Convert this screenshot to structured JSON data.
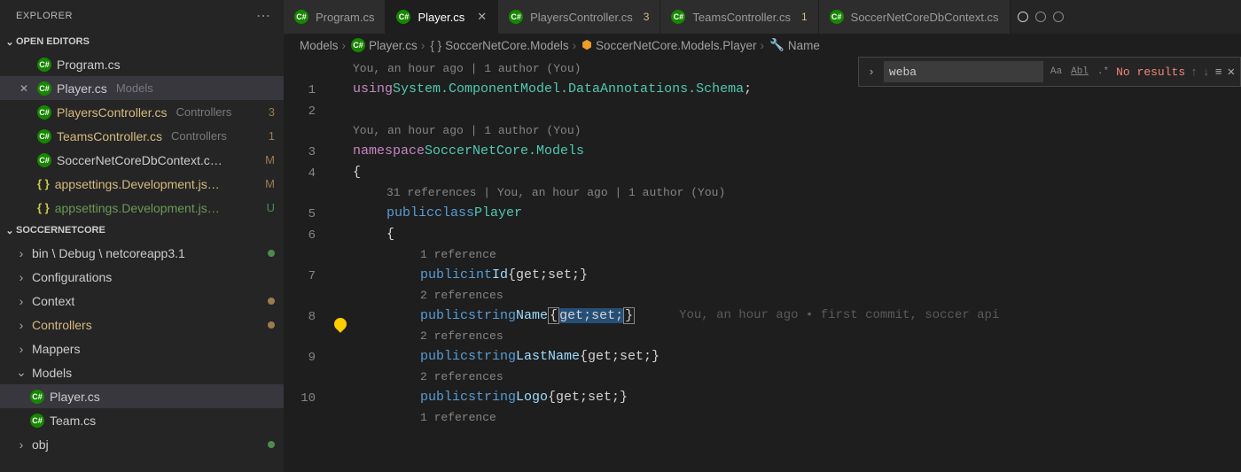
{
  "sidebar": {
    "title": "EXPLORER",
    "sections": {
      "open_editors": "OPEN EDITORS",
      "project": "SOCCERNETCORE"
    },
    "open_editors": [
      {
        "label": "Program.cs",
        "type": "cs"
      },
      {
        "label": "Player.cs",
        "dim": "Models",
        "type": "cs",
        "active": true,
        "closeable": true
      },
      {
        "label": "PlayersController.cs",
        "dim": "Controllers",
        "type": "cs",
        "git": "mod",
        "badge": "3"
      },
      {
        "label": "TeamsController.cs",
        "dim": "Controllers",
        "type": "cs",
        "git": "mod",
        "badge": "1"
      },
      {
        "label": "SoccerNetCoreDbContext.c…",
        "type": "cs",
        "badge": "M",
        "badgeClass": "mod"
      },
      {
        "label": "appsettings.Development.js…",
        "type": "json",
        "badge": "M",
        "badgeClass": "mod",
        "git": "mod"
      },
      {
        "label": "appsettings.Development.js…",
        "type": "json",
        "badge": "U",
        "badgeClass": "unt",
        "git": "unt"
      }
    ],
    "tree": [
      {
        "label": "bin \\ Debug \\ netcoreapp3.1",
        "dot": "green",
        "dim": true
      },
      {
        "label": "Configurations"
      },
      {
        "label": "Context",
        "dot": "amber"
      },
      {
        "label": "Controllers",
        "dot": "amber",
        "git": "mod"
      },
      {
        "label": "Mappers"
      }
    ],
    "models_folder": "Models",
    "models_files": [
      {
        "label": "Player.cs"
      },
      {
        "label": "Team.cs"
      }
    ],
    "obj_folder": "obj"
  },
  "tabs": [
    {
      "label": "Program.cs"
    },
    {
      "label": "Player.cs",
      "active": true
    },
    {
      "label": "PlayersController.cs",
      "badge": "3"
    },
    {
      "label": "TeamsController.cs",
      "badge": "1"
    },
    {
      "label": "SoccerNetCoreDbContext.cs"
    }
  ],
  "breadcrumb": {
    "p1": "Models",
    "p2": "Player.cs",
    "p3": "SoccerNetCore.Models",
    "p4": "SoccerNetCore.Models.Player",
    "p5": "Name"
  },
  "find": {
    "value": "weba",
    "result": "No results"
  },
  "code": {
    "lens1": "You, an hour ago | 1 author (You)",
    "lens2": "You, an hour ago | 1 author (You)",
    "lens3": "31 references | You, an hour ago | 1 author (You)",
    "ref1": "1 reference",
    "ref2": "2 references",
    "ref2b": "2 references",
    "ref2c": "2 references",
    "ref1b": "1 reference",
    "blame": "You, an hour ago • first commit, soccer api",
    "using": "using",
    "ns_text": "System.ComponentModel.DataAnnotations.Schema",
    "namespace": "namespace",
    "ns_name": "SoccerNetCore.Models",
    "public": "public",
    "class": "class",
    "className": "Player",
    "int": "int",
    "string": "string",
    "Id": "Id",
    "Name": "Name",
    "LastName": "LastName",
    "Logo": "Logo",
    "getset": "{get;set;}"
  },
  "line_numbers": [
    "1",
    "2",
    "",
    "3",
    "4",
    "",
    "5",
    "6",
    "",
    "7",
    "",
    "8",
    "",
    "9",
    "",
    "10",
    ""
  ]
}
